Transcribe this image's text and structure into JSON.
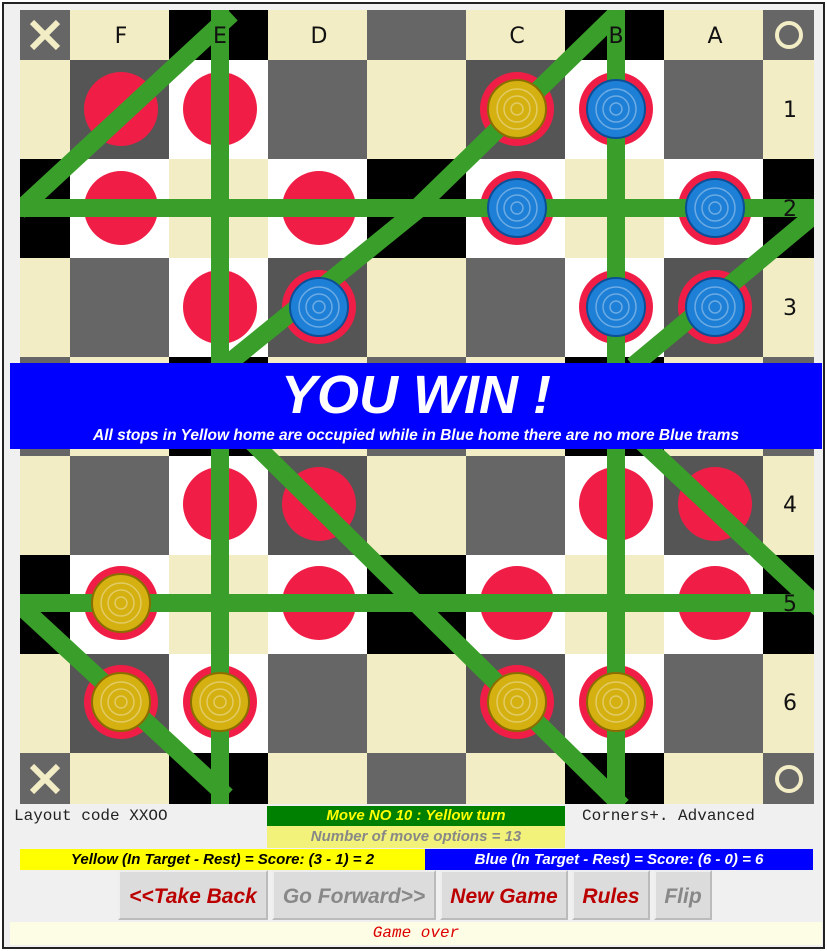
{
  "board": {
    "column_labels": [
      "F",
      "E",
      "D",
      "C",
      "B",
      "A"
    ],
    "row_labels": [
      "1",
      "2",
      "3",
      "4",
      "5",
      "6"
    ],
    "corner_icons": {
      "top_left": "x-mark-icon",
      "top_right": "circle-icon",
      "bottom_left": "x-mark-icon",
      "bottom_right": "circle-icon"
    },
    "stops": [
      "F1",
      "E1",
      "C1",
      "B1",
      "F2",
      "D2",
      "C2",
      "A2",
      "E3",
      "D3",
      "B3",
      "A3",
      "E4",
      "D4",
      "B4",
      "A4",
      "F5",
      "D5",
      "C5",
      "A5",
      "F6",
      "E6",
      "C6",
      "B6"
    ],
    "pieces": [
      {
        "color": "yellow",
        "cell": "C1"
      },
      {
        "color": "blue",
        "cell": "B1"
      },
      {
        "color": "blue",
        "cell": "C2"
      },
      {
        "color": "blue",
        "cell": "A2"
      },
      {
        "color": "blue",
        "cell": "D3"
      },
      {
        "color": "blue",
        "cell": "B3"
      },
      {
        "color": "blue",
        "cell": "A3"
      },
      {
        "color": "yellow",
        "cell": "F5"
      },
      {
        "color": "yellow",
        "cell": "F6"
      },
      {
        "color": "yellow",
        "cell": "E6"
      },
      {
        "color": "yellow",
        "cell": "C6"
      },
      {
        "color": "yellow",
        "cell": "B6"
      }
    ],
    "colors": {
      "track": "#3a9e2a",
      "stop": "#f01e46",
      "yellow_piece": "#d4b011",
      "blue_piece": "#1e7fd6"
    }
  },
  "banner": {
    "title": "YOU WIN !",
    "subtitle": "All stops in Yellow home are occupied while in Blue home there are no more Blue trams"
  },
  "info": {
    "layout_code": "Layout code XXOO",
    "variant": "Corners+. Advanced",
    "move": "Move NO 10 : Yellow turn",
    "move_options": "Number of move options = 13",
    "yellow_score": "Yellow (In Target - Rest) = Score: (3 - 1) = 2",
    "blue_score": "Blue (In Target - Rest) = Score: (6 - 0) = 6"
  },
  "buttons": {
    "take_back": "<<Take Back",
    "go_forward": "Go Forward>>",
    "new_game": "New Game",
    "rules": "Rules",
    "flip": "Flip"
  },
  "status": "Game over"
}
